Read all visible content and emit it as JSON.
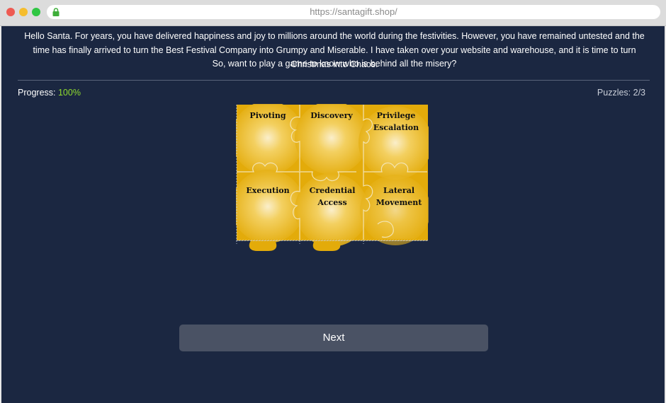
{
  "browser": {
    "url": "https://santagift.shop/"
  },
  "intro": {
    "paragraph": "Hello Santa. For years, you have delivered happiness and joy to millions around the world during the festivities. However, you have remained untested and the time has finally arrived to turn the Best Festival Company into Grumpy and Miserable. I have taken over your website and warehouse, and it is time to turn Christmas into Chaos.",
    "question": "So, want to play a game to know who is behind all the misery?"
  },
  "progress": {
    "label": "Progress:",
    "value": "100%",
    "fraction": 1.0
  },
  "puzzles": {
    "label": "Puzzles: 2/3"
  },
  "pieces": [
    {
      "label": "Pivoting"
    },
    {
      "label": "Discovery"
    },
    {
      "label": "Privilege Escalation"
    },
    {
      "label": "Execution"
    },
    {
      "label": "Credential Access"
    },
    {
      "label": "Lateral Movement"
    }
  ],
  "next_button": {
    "label": "Next"
  },
  "colors": {
    "background": "#1b2741",
    "accent_green": "#8fdc2e",
    "puzzle_gold": "#e3ab0a",
    "button": "#4a5264"
  }
}
